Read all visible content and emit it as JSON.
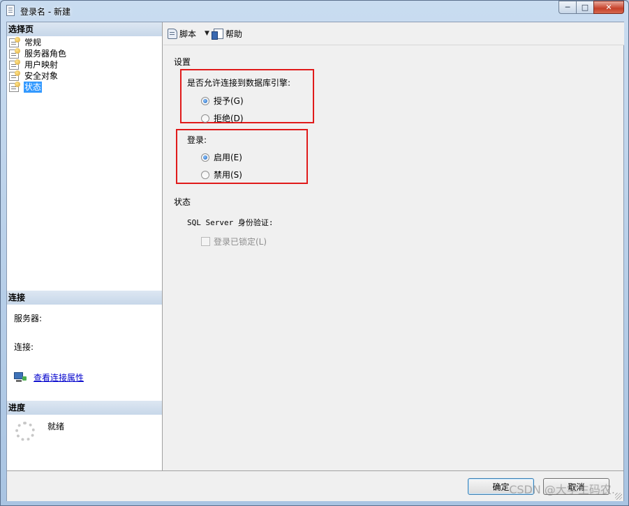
{
  "window": {
    "title": "登录名 - 新建",
    "buttons": {
      "minimize": "─",
      "maximize": "□",
      "close": "✕"
    }
  },
  "left": {
    "select_page_header": "选择页",
    "pages": [
      {
        "label": "常规",
        "selected": false
      },
      {
        "label": "服务器角色",
        "selected": false
      },
      {
        "label": "用户映射",
        "selected": false
      },
      {
        "label": "安全对象",
        "selected": false
      },
      {
        "label": "状态",
        "selected": true
      }
    ],
    "connection": {
      "header": "连接",
      "server_label": "服务器:",
      "connection_label": "连接:",
      "view_properties_link": "查看连接属性"
    },
    "progress": {
      "header": "进度",
      "status": "就绪"
    }
  },
  "toolbar": {
    "script_label": "脚本",
    "dropdown_arrow": "▼",
    "help_label": "帮助"
  },
  "settings": {
    "title": "设置",
    "engine_question": "是否允许连接到数据库引擎:",
    "grant_label": "授予(G)",
    "deny_label": "拒绝(D)",
    "engine_selected": "grant",
    "login_label": "登录:",
    "enabled_label": "启用(E)",
    "disabled_label": "禁用(S)",
    "login_selected": "enabled"
  },
  "status": {
    "title": "状态",
    "sql_auth_label": "SQL Server 身份验证:",
    "locked_label": "登录已锁定(L)",
    "locked_checked": false
  },
  "buttons": {
    "ok_label": "确定",
    "cancel_label": "取消"
  },
  "watermark": "CSDN @大学生码农."
}
